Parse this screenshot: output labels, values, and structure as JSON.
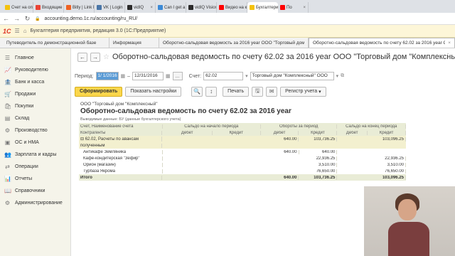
{
  "browser": {
    "tabs": [
      {
        "label": "Счет на опл",
        "color": "#f4c20d"
      },
      {
        "label": "Входящие",
        "color": "#ea4335"
      },
      {
        "label": "Bitly | Link M",
        "color": "#ee6123"
      },
      {
        "label": "VK | Login",
        "color": "#4a76a8"
      },
      {
        "label": "vidIQ",
        "color": "#2b2b2b"
      },
      {
        "label": "Can I get a f",
        "color": "#3c8ad6"
      },
      {
        "label": "vidIQ Vision",
        "color": "#2b2b2b"
      },
      {
        "label": "Видео на ка",
        "color": "#ff0000"
      },
      {
        "label": "Бухгалтерия",
        "color": "#f4c20d"
      },
      {
        "label": "По",
        "color": "#ff0000"
      }
    ],
    "url": "accounting.demo.1c.ru/accounting/ru_RU/"
  },
  "app": {
    "logo": "1С",
    "title": "Бухгалтерия предприятия, редакция 3.0  (1С:Предприятие)"
  },
  "open_tabs": [
    {
      "label": "Путеводитель по демонстрационной базе"
    },
    {
      "label": "Информация"
    },
    {
      "label": "Оборотно-сальдовая ведомость за 2016 year ООО \"Торговый дом \"Комплекс...\""
    },
    {
      "label": "Оборотно-сальдовая ведомость по счету 62.02 за 2016 year ООО \"Торговый д..."
    }
  ],
  "sidebar": {
    "items": [
      {
        "label": "Главное",
        "icon": "menu-icon"
      },
      {
        "label": "Руководителю",
        "icon": "chart-icon"
      },
      {
        "label": "Банк и касса",
        "icon": "bank-icon"
      },
      {
        "label": "Продажи",
        "icon": "sales-icon"
      },
      {
        "label": "Покупки",
        "icon": "cart-icon"
      },
      {
        "label": "Склад",
        "icon": "warehouse-icon"
      },
      {
        "label": "Производство",
        "icon": "factory-icon"
      },
      {
        "label": "ОС и НМА",
        "icon": "assets-icon"
      },
      {
        "label": "Зарплата и кадры",
        "icon": "people-icon"
      },
      {
        "label": "Операции",
        "icon": "operations-icon"
      },
      {
        "label": "Отчеты",
        "icon": "reports-icon"
      },
      {
        "label": "Справочники",
        "icon": "book-icon"
      },
      {
        "label": "Администрирование",
        "icon": "gear-icon"
      }
    ]
  },
  "form": {
    "title": "Оборотно-сальдовая ведомость по счету 62.02 за 2016 year ООО \"Торговый дом \"Комплексный\"",
    "period_label": "Период:",
    "period_from": "1/ 1/2016",
    "period_dash": "–",
    "period_to": "12/31/2016",
    "period_btn": "...",
    "account_label": "Счет:",
    "account_value": "62.02",
    "org_value": "Торговый дом \"Комплексный\" ООО",
    "form_btn": "Сформировать",
    "settings_btn": "Показать настройки",
    "print_btn": "Печать",
    "register_btn": "Регистр учета"
  },
  "report": {
    "org": "ООО \"Торговый дом \"Комплексный\"",
    "title": "Оборотно-сальдовая ведомость по счету 62.02 за 2016 year",
    "sub": "Выводимые данные:  БУ (данные бухгалтерского учета)",
    "header": {
      "col0_a": "Счет, Наименование счета",
      "col0_b": "Контрагенты",
      "open": "Сальдо на начало периода",
      "turn": "Обороты за период",
      "close": "Сальдо на конец периода",
      "debit": "Дебет",
      "credit": "Кредит"
    },
    "group": {
      "name": "62.02, Расчеты по авансам",
      "name2": "полученным",
      "turn_debit": "640.00",
      "turn_credit": "103,736.25",
      "close_credit": "103,096.25"
    },
    "rows": [
      {
        "name": "Антикафе Земляника",
        "od": "",
        "oc": "",
        "td": "640.00",
        "tc": "640.00",
        "cd": "",
        "cc": ""
      },
      {
        "name": "Кафе-кондитерская \"Зефир\"",
        "od": "",
        "oc": "",
        "td": "",
        "tc": "22,936.25",
        "cd": "",
        "cc": "22,936.25"
      },
      {
        "name": "Орион (магазин)",
        "od": "",
        "oc": "",
        "td": "",
        "tc": "3,510.00",
        "cd": "",
        "cc": "3,510.00"
      },
      {
        "name": "Турбаза Якрома",
        "od": "",
        "oc": "",
        "td": "",
        "tc": "76,650.00",
        "cd": "",
        "cc": "76,650.00"
      }
    ],
    "total": {
      "label": "Итого",
      "td": "640.00",
      "tc": "103,736.25",
      "cc": "103,096.25"
    }
  }
}
